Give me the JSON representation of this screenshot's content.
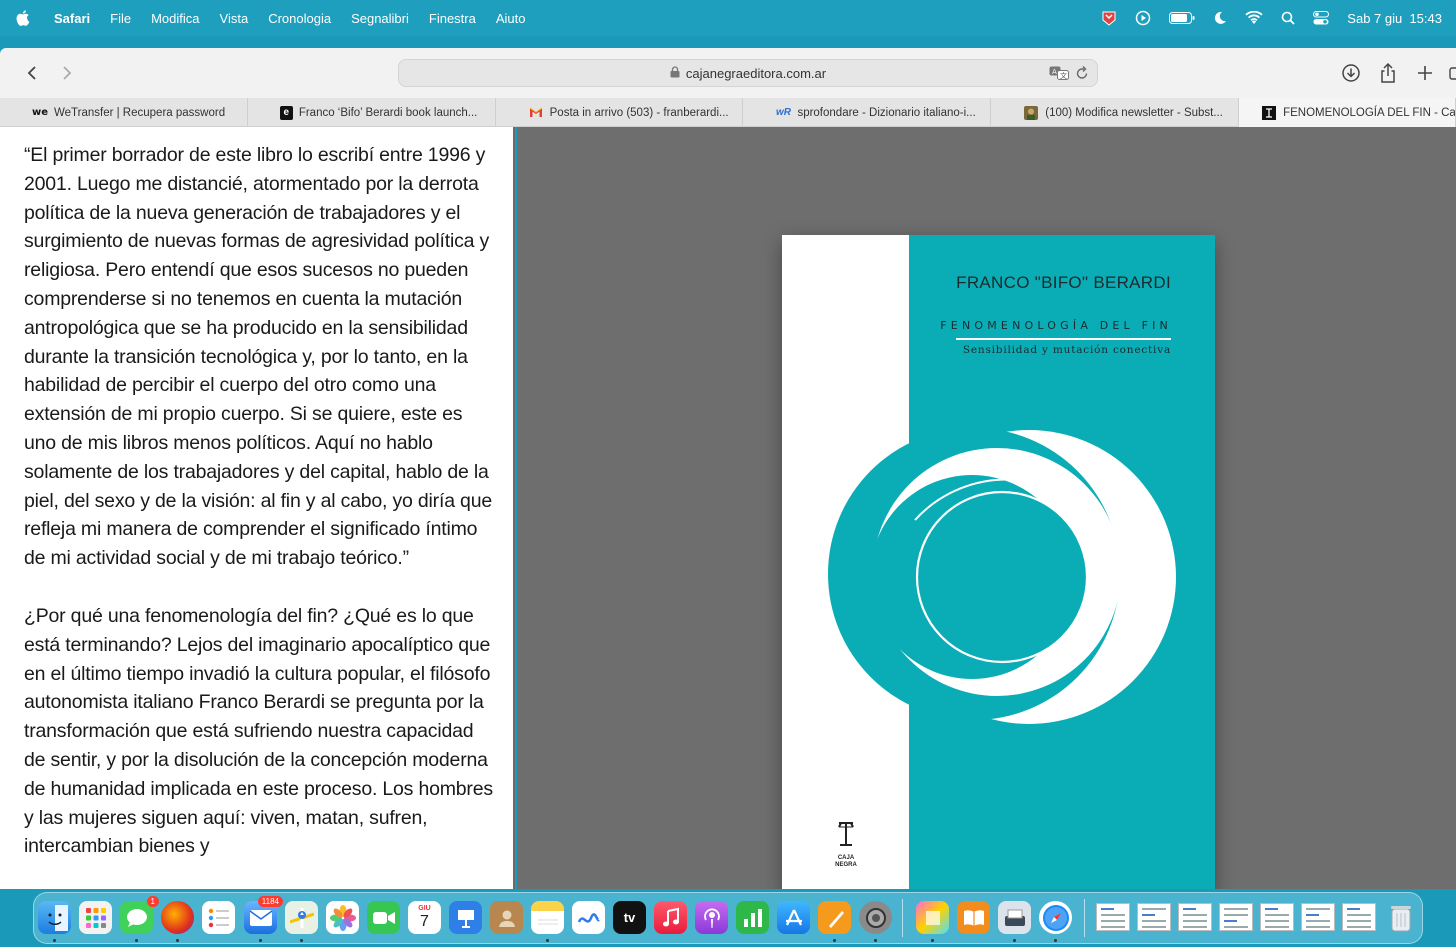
{
  "menubar": {
    "app_name": "Safari",
    "items": [
      "File",
      "Modifica",
      "Vista",
      "Cronologia",
      "Segnalibri",
      "Finestra",
      "Aiuto"
    ],
    "clock": "Sab 7 giu  15:43"
  },
  "toolbar": {
    "url": "cajanegraeditora.com.ar"
  },
  "tabs": [
    {
      "label": "WeTransfer | Recupera password",
      "favicon": "we"
    },
    {
      "label": "Franco ‘Bifo’ Berardi book launch...",
      "favicon": "e"
    },
    {
      "label": "Posta in arrivo (503) - franberardi...",
      "favicon": "M"
    },
    {
      "label": "sprofondare - Dizionario italiano-i...",
      "favicon": "wR"
    },
    {
      "label": "(100) Modifica newsletter - Subst...",
      "favicon": "avatar"
    },
    {
      "label": "FENOMENOLOGÍA DEL FIN - Caja",
      "favicon": "caja"
    }
  ],
  "article": {
    "paragraph1": "“El primer borrador de este libro lo escribí entre 1996 y 2001. Luego me distancié, atormentado por la derrota política de la nueva generación de trabajadores y el surgimiento de nuevas formas de agresividad política y religiosa. Pero entendí que esos sucesos no pueden comprenderse si no tenemos en cuenta la mutación antropológica que se ha producido en la sensibilidad durante la transición tecnológica y, por lo tanto, en la habilidad de percibir el cuerpo del otro como una extensión de mi propio cuerpo. Si se quiere, este es uno de mis libros menos políticos. Aquí no hablo solamente de los trabajadores y del capital, hablo de la piel, del sexo y de la visión: al fin y al cabo, yo diría que refleja mi manera de comprender el significado íntimo de mi actividad social y de mi trabajo teórico.”",
    "paragraph2": "¿Por qué una fenomenología del fin? ¿Qué es lo que está terminando? Lejos del imaginario apocalíptico que en el último tiempo invadió la cultura popular, el filósofo autonomista italiano Franco Berardi se pregunta por la transformación que está sufriendo nuestra capacidad de sentir, y por la disolución de la concepción moderna de humanidad implicada en este proceso. Los hombres y las mujeres siguen aquí: viven, matan, sufren, intercambian bienes y"
  },
  "cover": {
    "author": "FRANCO \"BIFO\" BERARDI",
    "title": "FENOMENOLOGÍA DEL FIN",
    "subtitle": "Sensibilidad y mutación conectiva",
    "publisher_line1": "CAJA",
    "publisher_line2": "NEGRA",
    "colors": {
      "teal": "#0aadb6",
      "background": "#6e6e6e"
    }
  },
  "dock": {
    "mail_badge": "1184",
    "messages_badge": "1",
    "calendar_month": "GIU",
    "calendar_day": "7",
    "tv_label": "tv"
  }
}
